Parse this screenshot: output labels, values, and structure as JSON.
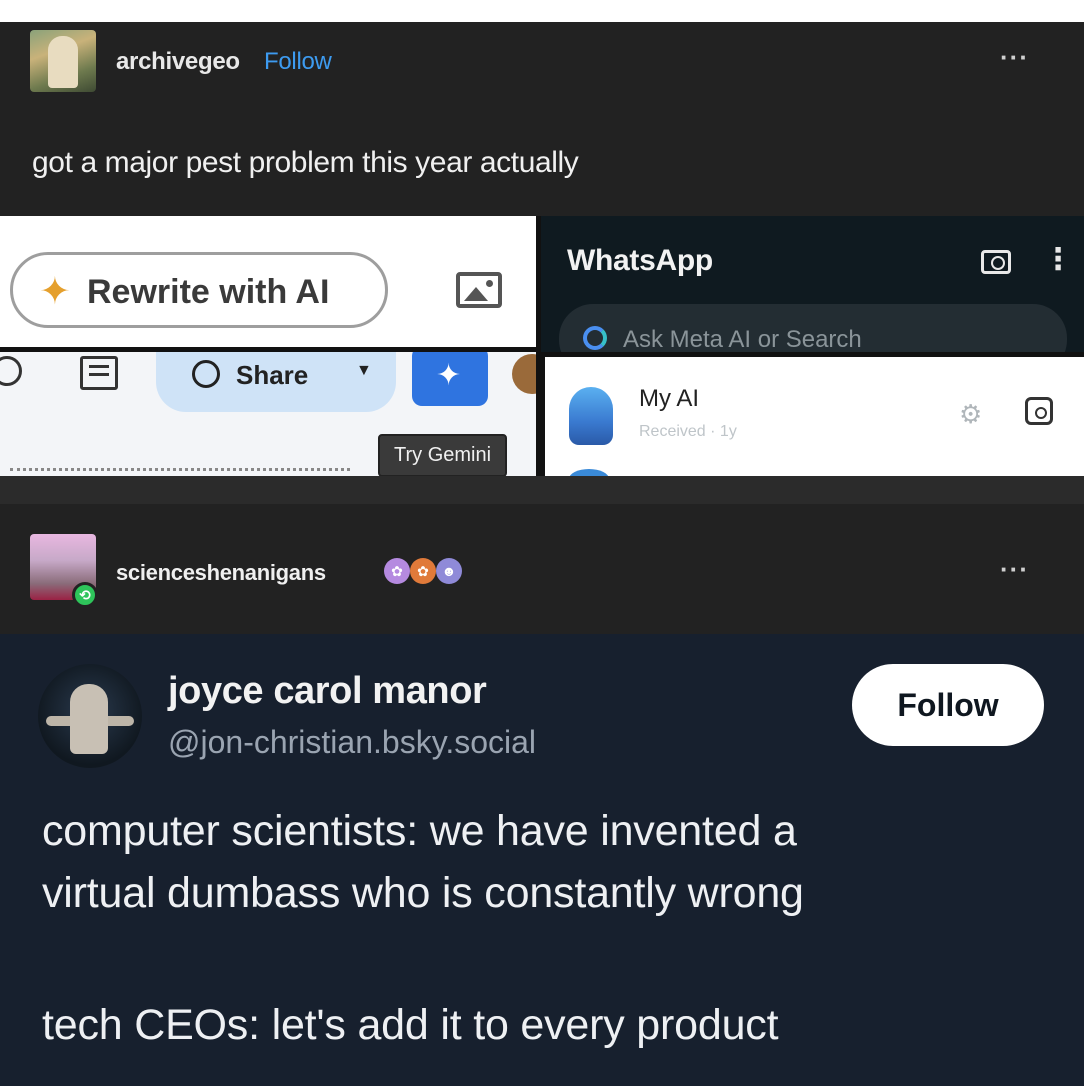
{
  "post1": {
    "username": "archivegeo",
    "follow_label": "Follow",
    "more_label": "···",
    "caption": "got a major pest problem this year actually",
    "collage": {
      "rewrite_label": "Rewrite with AI",
      "rewrite_icon": "sparkle-icon",
      "share_label": "Share",
      "tooltip": "Try Gemini",
      "whatsapp_title": "WhatsApp",
      "search_placeholder": "Ask Meta AI or Search",
      "chat_name": "My AI",
      "chat_status": "Received · 1y"
    }
  },
  "post2": {
    "username": "scienceshenanigans",
    "more_label": "···",
    "badges": [
      "badge-1",
      "badge-2",
      "badge-3"
    ]
  },
  "bsky": {
    "name": "joyce carol manor",
    "handle": "@jon-christian.bsky.social",
    "follow_label": "Follow",
    "line1": "computer scientists: we have invented a",
    "line2": "virtual dumbass who is constantly wrong",
    "line3": "tech CEOs: let's add it to every product"
  },
  "colors": {
    "background": "#222222",
    "bsky_background": "#17202e",
    "follow_link": "#3d9bf0",
    "gemini_blue": "#2f74e0",
    "reblog_green": "#2ec45a"
  }
}
